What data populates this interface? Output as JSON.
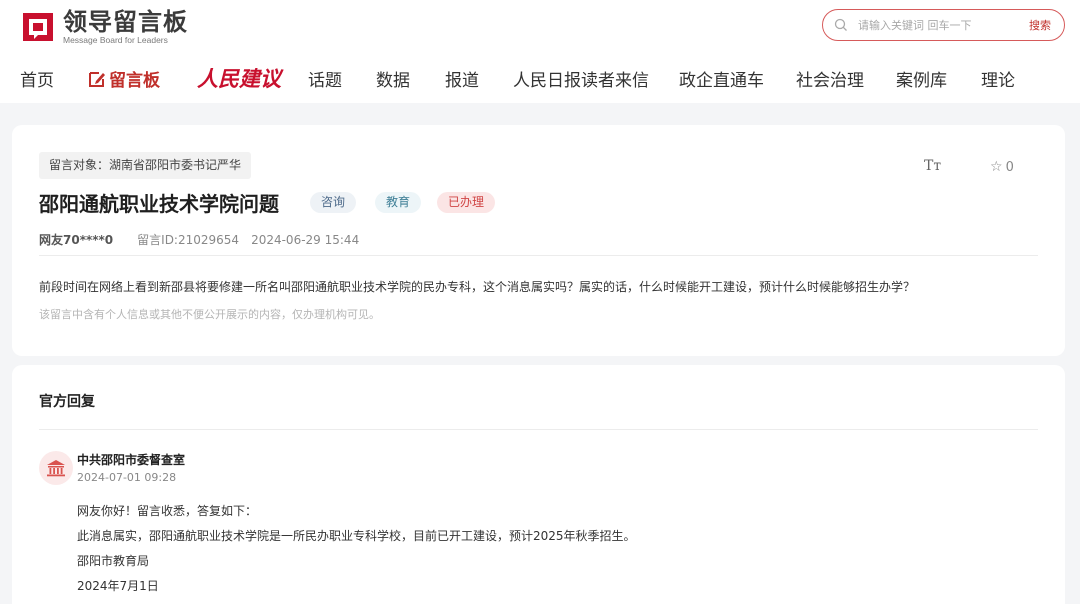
{
  "header": {
    "logo_title": "领导留言板",
    "logo_subtitle": "Message Board for Leaders",
    "search_placeholder": "请输入关键词 回车一下",
    "search_button": "搜索"
  },
  "nav": {
    "items": [
      "首页",
      "留言板",
      "人民建议",
      "话题",
      "数据",
      "报道",
      "人民日报读者来信",
      "政企直通车",
      "社会治理",
      "案例库",
      "理论"
    ],
    "active": "留言板"
  },
  "message": {
    "target": "留言对象：湖南省邵阳市委书记严华",
    "title": "邵阳通航职业技术学院问题",
    "tags": [
      "咨询",
      "教育",
      "已办理"
    ],
    "user": "网友70****0",
    "message_id": "留言ID:21029654",
    "time": "2024-06-29 15:44",
    "body": "前段时间在网络上看到新邵县将要修建一所名叫邵阳通航职业技术学院的民办专科，这个消息属实吗？属实的话，什么时候能开工建设，预计什么时候能够招生办学？",
    "note": "该留言中含有个人信息或其他不便公开展示的内容，仅办理机构可见。",
    "font_icon_label": "Tт",
    "star_count": "0"
  },
  "reply": {
    "heading": "官方回复",
    "org": "中共邵阳市委督查室",
    "time": "2024-07-01 09:28",
    "lines": [
      "网友你好！留言收悉，答复如下：",
      "此消息属实，邵阳通航职业技术学院是一所民办职业专科学校，目前已开工建设，预计2025年秋季招生。",
      "邵阳市教育局",
      "2024年7月1日"
    ]
  },
  "colors": {
    "accent": "#c0302b",
    "brand_red": "#c8102e",
    "page_bg": "#f4f5f7"
  }
}
